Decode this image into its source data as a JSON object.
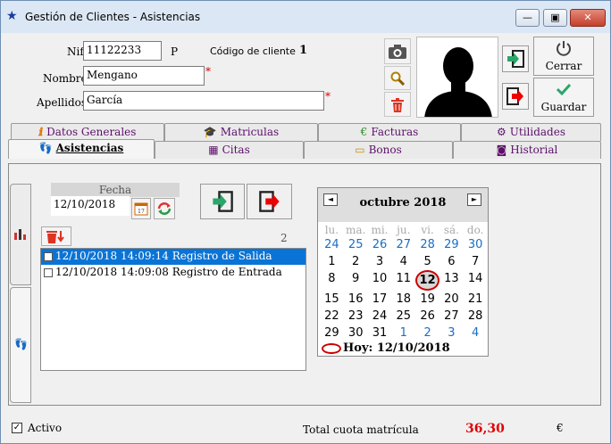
{
  "window": {
    "title": "Gestión de Clientes - Asistencias"
  },
  "header": {
    "nif_label": "Nif",
    "nif_value": "11122233",
    "nif_suffix": "P",
    "code_label": "Código de cliente",
    "code_value": "1",
    "nombre_label": "Nombre",
    "nombre_value": "Mengano",
    "apellidos_label": "Apellidos",
    "apellidos_value": "García",
    "required_mark": "*",
    "cerrar_label": "Cerrar",
    "guardar_label": "Guardar"
  },
  "tabs_row1": [
    {
      "label": "Datos Generales",
      "icon": "exclamation-icon"
    },
    {
      "label": "Matriculas",
      "icon": "graduation-cap-icon"
    },
    {
      "label": "Facturas",
      "icon": "money-icon"
    },
    {
      "label": "Utilidades",
      "icon": "gear-icon"
    }
  ],
  "tabs_row2": [
    {
      "label": "Asistencias",
      "icon": "footprints-icon",
      "selected": true
    },
    {
      "label": "Citas",
      "icon": "calendar-icon"
    },
    {
      "label": "Bonos",
      "icon": "ticket-icon"
    },
    {
      "label": "Historial",
      "icon": "camera-icon"
    }
  ],
  "asistencias": {
    "fecha_label": "Fecha",
    "fecha_value": "12/10/2018",
    "count": "2",
    "records": [
      {
        "text": "12/10/2018 14:09:14 Registro de Salida",
        "selected": true
      },
      {
        "text": "12/10/2018 14:09:08 Registro de Entrada",
        "selected": false
      }
    ]
  },
  "calendar": {
    "month_label": "octubre 2018",
    "prev": "◄",
    "next": "►",
    "weekdays": [
      "lu.",
      "ma.",
      "mi.",
      "ju.",
      "vi.",
      "sá.",
      "do."
    ],
    "weeks": [
      [
        "24",
        "25",
        "26",
        "27",
        "28",
        "29",
        "30"
      ],
      [
        "1",
        "2",
        "3",
        "4",
        "5",
        "6",
        "7"
      ],
      [
        "8",
        "9",
        "10",
        "11",
        "12",
        "13",
        "14"
      ],
      [
        "15",
        "16",
        "17",
        "18",
        "19",
        "20",
        "21"
      ],
      [
        "22",
        "23",
        "24",
        "25",
        "26",
        "27",
        "28"
      ],
      [
        "29",
        "30",
        "31",
        "1",
        "2",
        "3",
        "4"
      ]
    ],
    "today_label": "Hoy: 12/10/2018"
  },
  "footer": {
    "activo_label": "Activo",
    "total_label": "Total cuota matrícula",
    "total_value": "36,30",
    "currency": "€"
  },
  "colors": {
    "accent_red": "#e00000",
    "selected_blue": "#0a74d6",
    "tab_purple": "#5c0f6b"
  }
}
